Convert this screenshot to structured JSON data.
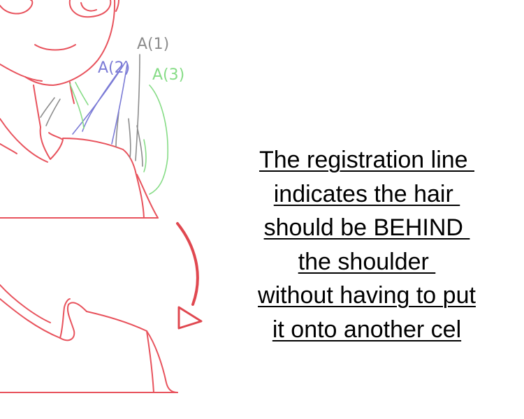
{
  "annotation": {
    "lines": [
      "The registration line ",
      "indicates the hair ",
      "should be BEHIND ",
      "the shoulder ",
      "without having to put",
      "it onto another cel"
    ]
  },
  "layer_labels": {
    "a1": "A(1)",
    "a2": "A(2)",
    "a3": "A(3)"
  },
  "colors": {
    "line_art": "#e8535d",
    "layer_a1": "#8c8c8c",
    "layer_a2": "#7b7bd6",
    "layer_a3": "#86dc86",
    "arrow": "#e04850",
    "text": "#000000"
  }
}
